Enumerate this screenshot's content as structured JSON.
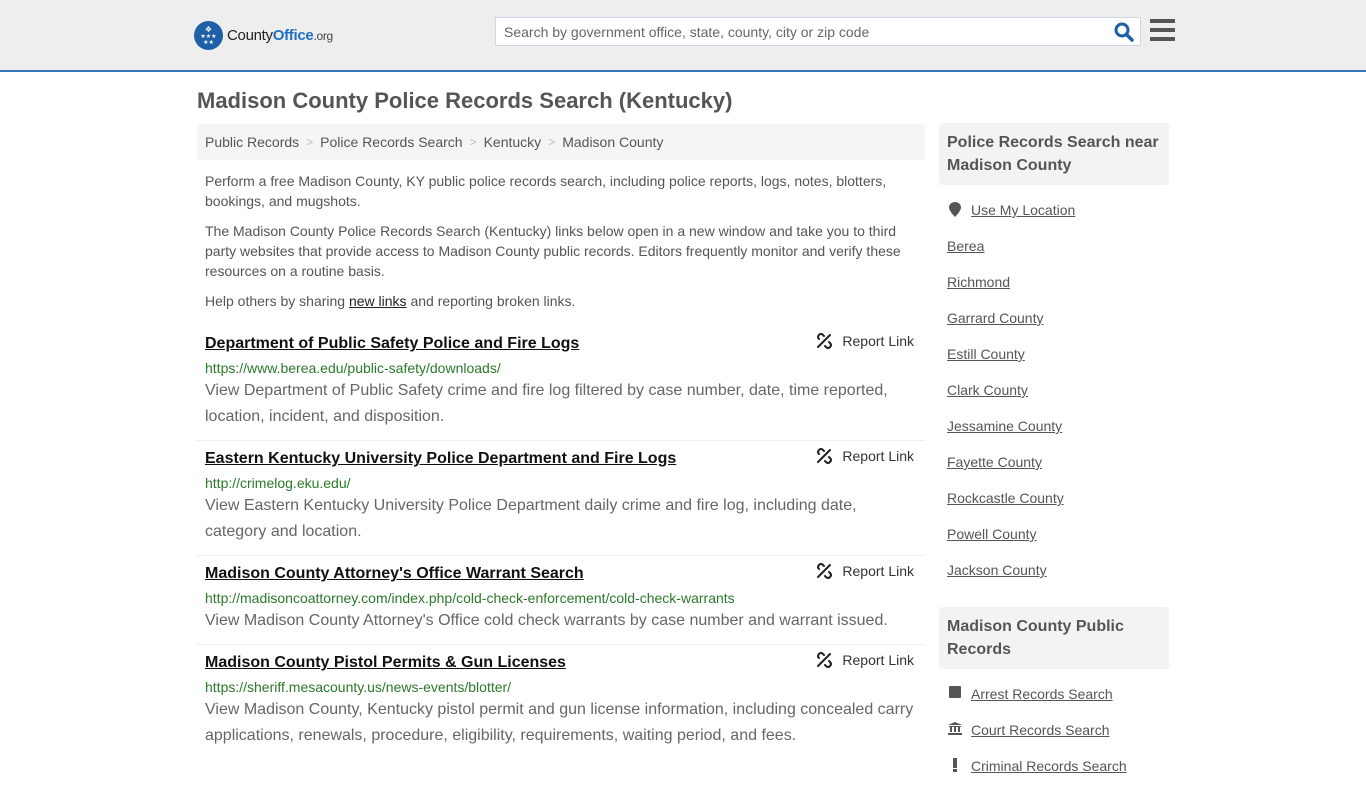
{
  "header": {
    "logo": {
      "name_part1": "County",
      "name_part2": "Office",
      "tld": ".org"
    },
    "search": {
      "placeholder": "Search by government office, state, county, city or zip code",
      "value": ""
    },
    "colors": {
      "accent": "#337ab7",
      "logo_blue": "#1e5fa8"
    }
  },
  "page": {
    "title": "Madison County Police Records Search (Kentucky)"
  },
  "breadcrumb": [
    {
      "label": "Public Records"
    },
    {
      "label": "Police Records Search"
    },
    {
      "label": "Kentucky"
    },
    {
      "label": "Madison County"
    }
  ],
  "intro": {
    "p1": "Perform a free Madison County, KY public police records search, including police reports, logs, notes, blotters, bookings, and mugshots.",
    "p2": "The Madison County Police Records Search (Kentucky) links below open in a new window and take you to third party websites that provide access to Madison County public records. Editors frequently monitor and verify these resources on a routine basis.",
    "p3_before": "Help others by sharing ",
    "p3_link": "new links",
    "p3_after": " and reporting broken links."
  },
  "results": [
    {
      "title": "Department of Public Safety Police and Fire Logs",
      "url": "https://www.berea.edu/public-safety/downloads/",
      "description": "View Department of Public Safety crime and fire log filtered by case number, date, time reported, location, incident, and disposition.",
      "report_label": "Report Link"
    },
    {
      "title": "Eastern Kentucky University Police Department and Fire Logs",
      "url": "http://crimelog.eku.edu/",
      "description": "View Eastern Kentucky University Police Department daily crime and fire log, including date, category and location.",
      "report_label": "Report Link"
    },
    {
      "title": "Madison County Attorney's Office Warrant Search",
      "url": "http://madisoncoattorney.com/index.php/cold-check-enforcement/cold-check-warrants",
      "description": "View Madison County Attorney's Office cold check warrants by case number and warrant issued.",
      "report_label": "Report Link"
    },
    {
      "title": "Madison County Pistol Permits & Gun Licenses",
      "url": "https://sheriff.mesacounty.us/news-events/blotter/",
      "description": "View Madison County, Kentucky pistol permit and gun license information, including concealed carry applications, renewals, procedure, eligibility, requirements, waiting period, and fees.",
      "report_label": "Report Link"
    }
  ],
  "sidebar": {
    "nearby": {
      "heading": "Police Records Search near Madison County",
      "use_location": "Use My Location",
      "items": [
        "Berea",
        "Richmond",
        "Garrard County",
        "Estill County",
        "Clark County",
        "Jessamine County",
        "Fayette County",
        "Rockcastle County",
        "Powell County",
        "Jackson County"
      ]
    },
    "public_records": {
      "heading": "Madison County Public Records",
      "items": [
        {
          "label": "Arrest Records Search",
          "icon": "square-icon"
        },
        {
          "label": "Court Records Search",
          "icon": "courthouse-icon"
        },
        {
          "label": "Criminal Records Search",
          "icon": "exclamation-icon"
        }
      ]
    }
  }
}
